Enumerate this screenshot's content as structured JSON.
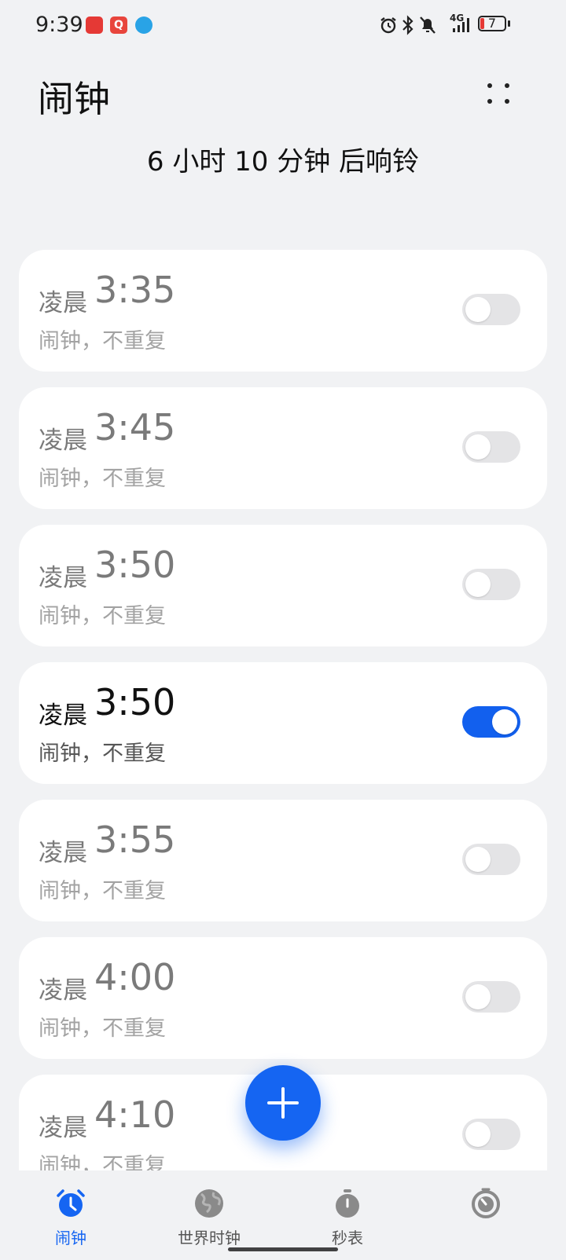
{
  "status_bar": {
    "time": "9:39",
    "network": "4G",
    "battery": "7",
    "icons": [
      "alarm-icon",
      "bluetooth-icon",
      "mute-icon",
      "signal-icon"
    ]
  },
  "header": {
    "title": "闹钟",
    "countdown": "6 小时 10 分钟 后响铃"
  },
  "alarms": [
    {
      "period": "凌晨",
      "time": "3:35",
      "label": "闹钟，不重复",
      "enabled": false
    },
    {
      "period": "凌晨",
      "time": "3:45",
      "label": "闹钟，不重复",
      "enabled": false
    },
    {
      "period": "凌晨",
      "time": "3:50",
      "label": "闹钟，不重复",
      "enabled": false
    },
    {
      "period": "凌晨",
      "time": "3:50",
      "label": "闹钟，不重复",
      "enabled": true
    },
    {
      "period": "凌晨",
      "time": "3:55",
      "label": "闹钟，不重复",
      "enabled": false
    },
    {
      "period": "凌晨",
      "time": "4:00",
      "label": "闹钟，不重复",
      "enabled": false
    },
    {
      "period": "凌晨",
      "time": "4:10",
      "label": "闹钟，不重复",
      "enabled": false
    }
  ],
  "bottom_nav": [
    {
      "label": "闹钟",
      "icon": "alarm-clock-icon",
      "active": true
    },
    {
      "label": "世界时钟",
      "icon": "globe-icon",
      "active": false
    },
    {
      "label": "秒表",
      "icon": "stopwatch-icon",
      "active": false
    },
    {
      "label": "",
      "icon": "timer-icon",
      "active": false
    }
  ],
  "colors": {
    "accent": "#1565f2",
    "background": "#f1f2f4",
    "card": "#ffffff",
    "toggle_off": "#e4e4e6"
  }
}
